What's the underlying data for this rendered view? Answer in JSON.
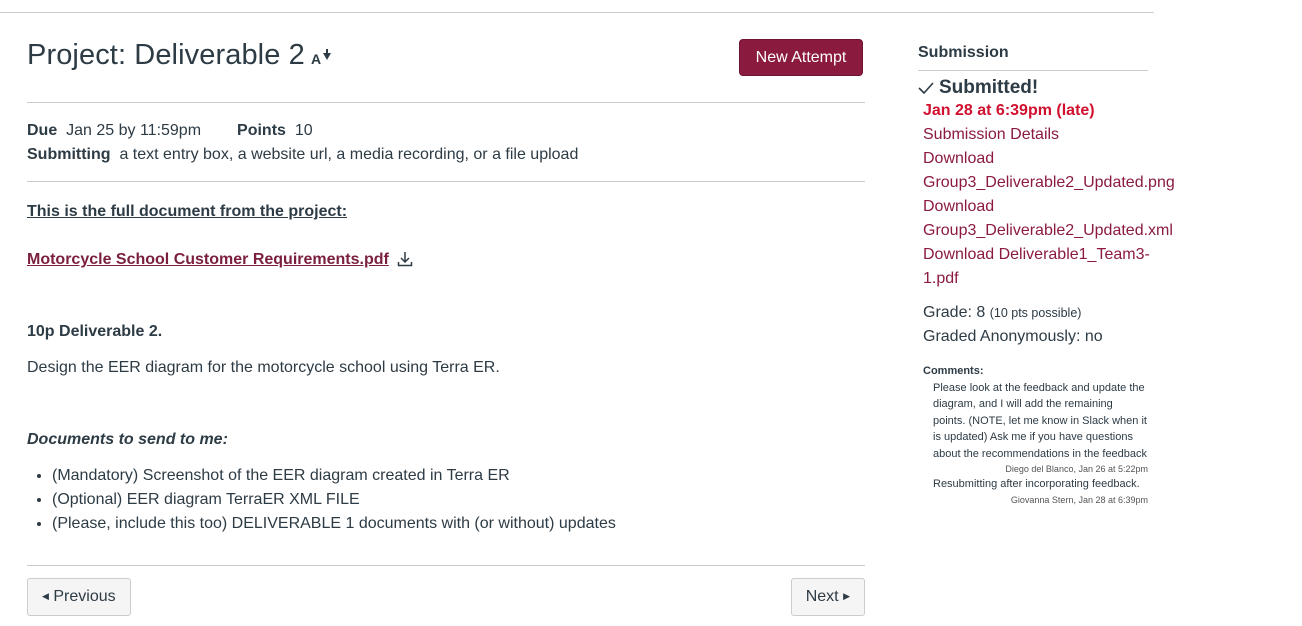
{
  "assignment": {
    "title": "Project: Deliverable 2",
    "new_attempt_label": "New Attempt",
    "due_label": "Due",
    "due_value": "Jan 25 by 11:59pm",
    "points_label": "Points",
    "points_value": "10",
    "submitting_label": "Submitting",
    "submitting_value": "a text entry box, a website url, a media recording, or a file upload"
  },
  "content": {
    "intro": "This is the full document from the project:",
    "pdf_link": "Motorcycle School Customer Requirements.pdf",
    "deliverable_title": "10p Deliverable 2.",
    "deliverable_desc": "Design the EER diagram for the motorcycle school using Terra ER.",
    "docs_title": "Documents to send to me:",
    "docs": [
      "(Mandatory) Screenshot of the EER diagram created in Terra ER",
      "(Optional) EER diagram TerraER XML FILE",
      "(Please, include this too) DELIVERABLE 1 documents with (or without) updates"
    ]
  },
  "nav": {
    "previous": "Previous",
    "next": "Next"
  },
  "submission": {
    "heading": "Submission",
    "status": "Submitted!",
    "date": "Jan 28 at 6:39pm (late)",
    "details_link": "Submission Details",
    "downloads": [
      "Download Group3_Deliverable2_Updated.png",
      "Download Group3_Deliverable2_Updated.xml",
      "Download Deliverable1_Team3-1.pdf"
    ],
    "download_lines": [
      "Download",
      "Group3_Deliverable2_Updated.png",
      "Download",
      "Group3_Deliverable2_Updated.xml",
      "Download Deliverable1_Team3-",
      "1.pdf"
    ],
    "grade_label": "Grade: 8",
    "grade_possible": "(10 pts possible)",
    "graded_anon": "Graded Anonymously: no",
    "comments_label": "Comments:",
    "comments": [
      {
        "text": "Please look at the feedback and update the diagram, and I will add the remaining points. (NOTE, let me know in Slack when it is updated) Ask me if you have questions about the recommendations in the feedback",
        "author": "Diego del Blanco, Jan 26 at 5:22pm"
      },
      {
        "text": "Resubmitting after incorporating feedback.",
        "author": "Giovanna Stern, Jan 28 at 6:39pm"
      }
    ]
  },
  "colors": {
    "brand": "#8b1a3f",
    "late": "#d0102e",
    "text": "#2d3b45"
  }
}
